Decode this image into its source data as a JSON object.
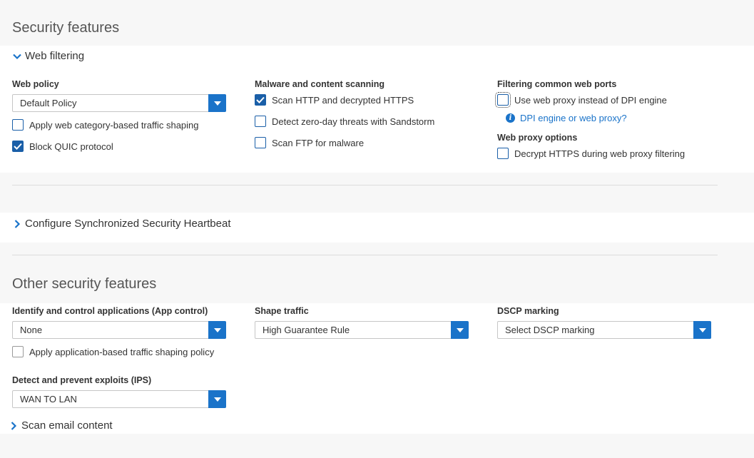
{
  "security_features": {
    "title": "Security features",
    "web_filtering": {
      "toggle_label": "Web filtering",
      "web_policy": {
        "label": "Web policy",
        "value": "Default Policy",
        "traffic_shaping_label": "Apply web category-based traffic shaping",
        "traffic_shaping_checked": false,
        "block_quic_label": "Block QUIC protocol",
        "block_quic_checked": true
      },
      "malware": {
        "label": "Malware and content scanning",
        "scan_http_label": "Scan HTTP and decrypted HTTPS",
        "scan_http_checked": true,
        "sandstorm_label": "Detect zero-day threats with Sandstorm",
        "sandstorm_checked": false,
        "scan_ftp_label": "Scan FTP for malware",
        "scan_ftp_checked": false
      },
      "common_ports": {
        "label": "Filtering common web ports",
        "use_proxy_label": "Use web proxy instead of DPI engine",
        "use_proxy_checked": false,
        "help_link": "DPI engine or web proxy?"
      },
      "proxy_options": {
        "label": "Web proxy options",
        "decrypt_label": "Decrypt HTTPS during web proxy filtering",
        "decrypt_checked": false
      }
    },
    "heartbeat_toggle_label": "Configure Synchronized Security Heartbeat"
  },
  "other_security_features": {
    "title": "Other security features",
    "app_control": {
      "label": "Identify and control applications (App control)",
      "value": "None",
      "shaping_label": "Apply application-based traffic shaping policy",
      "shaping_checked": false
    },
    "shape_traffic": {
      "label": "Shape traffic",
      "value": "High Guarantee Rule"
    },
    "dscp": {
      "label": "DSCP marking",
      "value": "Select DSCP marking"
    },
    "ips": {
      "label": "Detect and prevent exploits (IPS)",
      "value": "WAN TO LAN"
    },
    "scan_email_toggle_label": "Scan email content"
  },
  "colors": {
    "accent": "#1a73c9",
    "checkbox": "#1a5fa8",
    "page_bg": "#f7f7f7",
    "panel_bg": "#ffffff"
  }
}
